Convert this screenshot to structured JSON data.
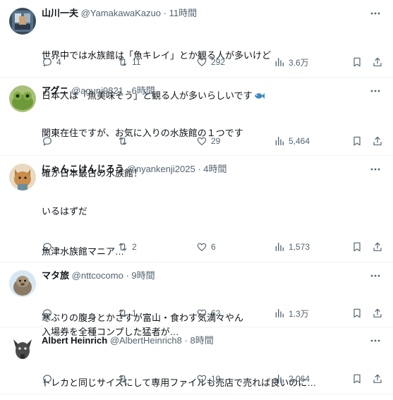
{
  "tweets": [
    {
      "name": "山川一夫",
      "handle": "@YamakawaKazuo",
      "dot": "·",
      "time": "11時間",
      "lines": [
        "世界中では水族館は「魚キレイ」とか観る人が多いけど",
        "日本人は「魚美味そう」と観る人が多いらしいです"
      ],
      "emoji": "fish-emoji",
      "replies": "4",
      "retweets": "11",
      "likes": "292",
      "views": "3.6万"
    },
    {
      "name": "アグニ",
      "handle": "@aguni9821",
      "dot": "·",
      "time": "6時間",
      "lines": [
        "関東在住ですが、お気に入りの水族館の１つです",
        "確か日本最古の水族館！"
      ],
      "replies": "",
      "retweets": "",
      "likes": "29",
      "views": "5,464"
    },
    {
      "name": "にゃんこけんじろう",
      "handle": "@nyankenji2025",
      "dot": "·",
      "time": "4時間",
      "lines": [
        "いるはずだ",
        "魚津水族館マニア…",
        "",
        "入場券を全種コンプした猛者が…"
      ],
      "replies": "",
      "retweets": "2",
      "likes": "6",
      "views": "1,573"
    },
    {
      "name": "マタ旅",
      "handle": "@nttcocomo",
      "dot": "·",
      "time": "9時間",
      "lines": [
        "寒ぶりの腹身とかさすが富山・食わす気満々やん"
      ],
      "replies": "",
      "retweets": "1",
      "likes": "62",
      "views": "1.3万"
    },
    {
      "name": "Albert Heinrich",
      "handle": "@AlbertHeinrich8",
      "dot": "·",
      "time": "8時間",
      "lines": [
        "トレカと同じサイズにして専用ファイルも売店で売れば良いのに…"
      ],
      "replies": "",
      "retweets": "",
      "likes": "10",
      "views": "2,064"
    }
  ],
  "icons": {
    "more": "more-dots-icon",
    "reply": "reply-icon",
    "retweet": "retweet-icon",
    "like": "heart-icon",
    "views": "views-icon",
    "bookmark": "bookmark-icon",
    "share": "share-icon"
  },
  "colors": {
    "text": "#0f1419",
    "secondary": "#536471",
    "divider": "#eff3f4",
    "fish_emoji": "#3b88c3"
  }
}
